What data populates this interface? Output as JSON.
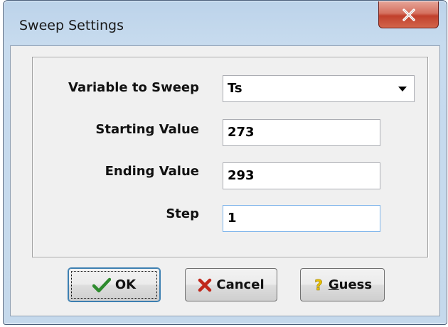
{
  "window": {
    "title": "Sweep Settings"
  },
  "form": {
    "variable": {
      "label": "Variable to Sweep",
      "value": "Ts"
    },
    "start": {
      "label": "Starting Value",
      "value": "273"
    },
    "end": {
      "label": "Ending Value",
      "value": "293"
    },
    "step": {
      "label": "Step",
      "value": "1"
    }
  },
  "buttons": {
    "ok": {
      "label": "OK",
      "icon": "checkmark-icon",
      "color": "#2e8b2e"
    },
    "cancel": {
      "label": "Cancel",
      "icon": "cross-icon",
      "color": "#c0281c"
    },
    "guess": {
      "label_first": "G",
      "label_rest": "uess",
      "icon": "question-mark-icon",
      "color": "#e8c000"
    }
  }
}
